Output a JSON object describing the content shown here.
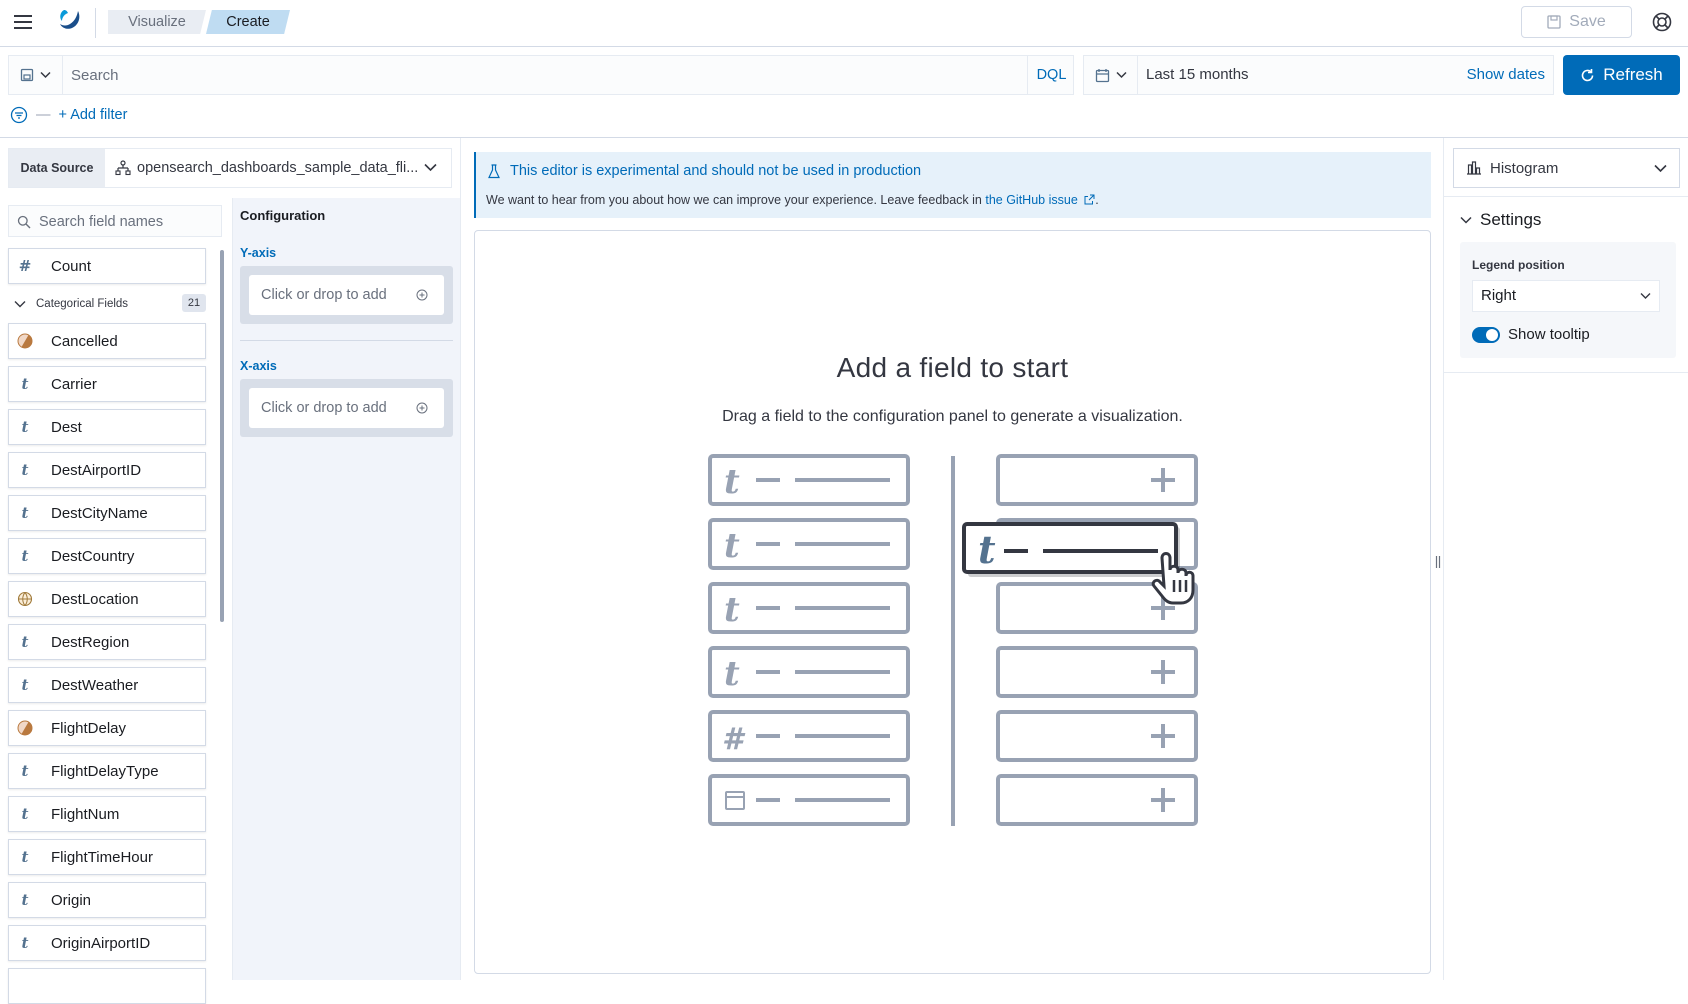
{
  "header": {
    "breadcrumbs": [
      "Visualize",
      "Create"
    ],
    "save_label": "Save"
  },
  "query": {
    "search_placeholder": "Search",
    "language": "DQL",
    "date_range": "Last 15 months",
    "show_dates": "Show dates",
    "refresh_label": "Refresh",
    "add_filter": "+ Add filter"
  },
  "datasource": {
    "label": "Data Source",
    "value": "opensearch_dashboards_sample_data_fli..."
  },
  "fields": {
    "search_placeholder": "Search field names",
    "count_label": "Count",
    "categorical_heading": "Categorical Fields",
    "categorical_count": "21",
    "items": [
      {
        "name": "Cancelled",
        "type": "boolean"
      },
      {
        "name": "Carrier",
        "type": "string"
      },
      {
        "name": "Dest",
        "type": "string"
      },
      {
        "name": "DestAirportID",
        "type": "string"
      },
      {
        "name": "DestCityName",
        "type": "string"
      },
      {
        "name": "DestCountry",
        "type": "string"
      },
      {
        "name": "DestLocation",
        "type": "geo"
      },
      {
        "name": "DestRegion",
        "type": "string"
      },
      {
        "name": "DestWeather",
        "type": "string"
      },
      {
        "name": "FlightDelay",
        "type": "boolean"
      },
      {
        "name": "FlightDelayType",
        "type": "string"
      },
      {
        "name": "FlightNum",
        "type": "string"
      },
      {
        "name": "FlightTimeHour",
        "type": "string"
      },
      {
        "name": "Origin",
        "type": "string"
      },
      {
        "name": "OriginAirportID",
        "type": "string"
      }
    ]
  },
  "config": {
    "title": "Configuration",
    "y_axis_label": "Y-axis",
    "x_axis_label": "X-axis",
    "drop_text": "Click or drop to add"
  },
  "main": {
    "callout_title": "This editor is experimental and should not be used in production",
    "callout_body": "We want to hear from you about how we can improve your experience. Leave feedback in ",
    "callout_link": "the GitHub issue",
    "empty_title": "Add a field to start",
    "empty_subtitle": "Drag a field to the configuration panel to generate a visualization."
  },
  "right": {
    "vis_type": "Histogram",
    "settings_title": "Settings",
    "legend_position_label": "Legend position",
    "legend_position_value": "Right",
    "show_tooltip_label": "Show tooltip"
  },
  "colors": {
    "accent": "#006bb8",
    "callout_bg": "#e6f1fa",
    "token_string": "#54728f",
    "token_boolean": "#d6926b"
  }
}
